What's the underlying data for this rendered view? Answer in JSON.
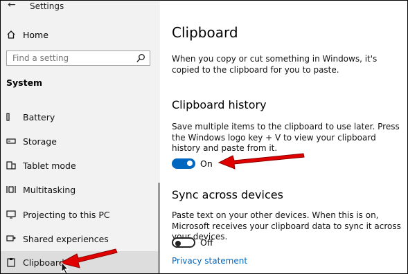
{
  "window": {
    "title": "Settings"
  },
  "sidebar": {
    "home_label": "Home",
    "search_placeholder": "Find a setting",
    "section_title": "System",
    "items": [
      {
        "label": "Battery"
      },
      {
        "label": "Storage"
      },
      {
        "label": "Tablet mode"
      },
      {
        "label": "Multitasking"
      },
      {
        "label": "Projecting to this PC"
      },
      {
        "label": "Shared experiences"
      },
      {
        "label": "Clipboard"
      }
    ]
  },
  "main": {
    "heading": "Clipboard",
    "description": "When you copy or cut something in Windows, it's copied to the clipboard for you to paste.",
    "clipboard_history": {
      "title": "Clipboard history",
      "description": "Save multiple items to the clipboard to use later. Press the Windows logo key + V to view your clipboard history and paste from it.",
      "toggle_state": "On"
    },
    "sync": {
      "title": "Sync across devices",
      "description": "Paste text on your other devices. When this is on, Microsoft receives your clipboard data to sync it across your devices.",
      "toggle_state": "Off"
    },
    "privacy_link": "Privacy statement"
  },
  "colors": {
    "accent": "#0067c0",
    "sidebar_bg": "#f2f2f2",
    "selected_bg": "#dddddd",
    "annotation_arrow": "#e00000"
  }
}
